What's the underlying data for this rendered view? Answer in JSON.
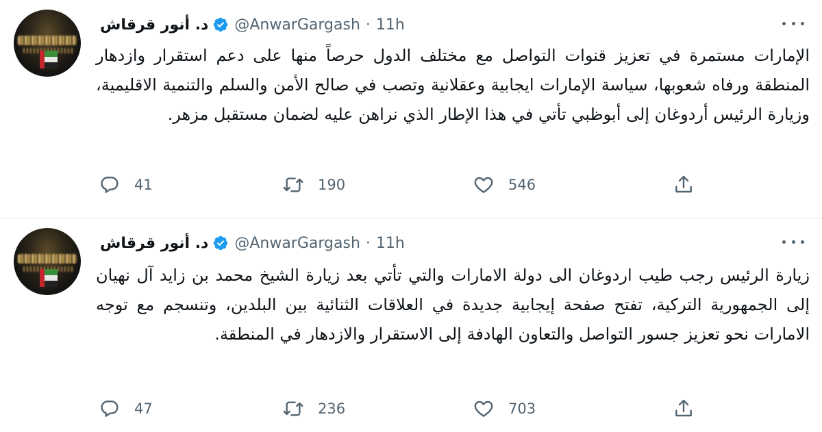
{
  "tweets": [
    {
      "name": "د. أنور قرقاش",
      "handle": "@AnwarGargash",
      "separator": "·",
      "time": "11h",
      "text": "الإمارات مستمرة في تعزيز قنوات التواصل مع مختلف الدول حرصاً منها على دعم استقرار وازدهار المنطقة ورفاه شعوبها، سياسة الإمارات ايجابية وعقلانية وتصب في صالح الأمن والسلم والتنمية الاقليمية، وزيارة الرئيس أردوغان إلى أبوظبي تأتي في هذا الإطار الذي نراهن عليه لضمان مستقبل مزهر.",
      "replies": "41",
      "retweets": "190",
      "likes": "546"
    },
    {
      "name": "د. أنور قرقاش",
      "handle": "@AnwarGargash",
      "separator": "·",
      "time": "11h",
      "text": "زيارة الرئيس رجب طيب اردوغان الى دولة الامارات والتي تأتي بعد زيارة الشيخ محمد بن زايد آل نهيان إلى الجمهورية التركية، تفتح صفحة إيجابية جديدة في العلاقات الثنائية بين البلدين، وتنسجم مع توجه الامارات نحو تعزيز جسور التواصل والتعاون الهادفة إلى الاستقرار والازدهار في المنطقة.",
      "replies": "47",
      "retweets": "236",
      "likes": "703"
    }
  ],
  "icons": {
    "verified": "verified-badge-icon",
    "more": "more-horizontal-icon",
    "reply": "reply-icon",
    "retweet": "retweet-icon",
    "like": "heart-icon",
    "share": "share-icon"
  },
  "colors": {
    "verified": "#1d9bf0",
    "secondary_text": "#536471",
    "primary_text": "#0f1419"
  }
}
